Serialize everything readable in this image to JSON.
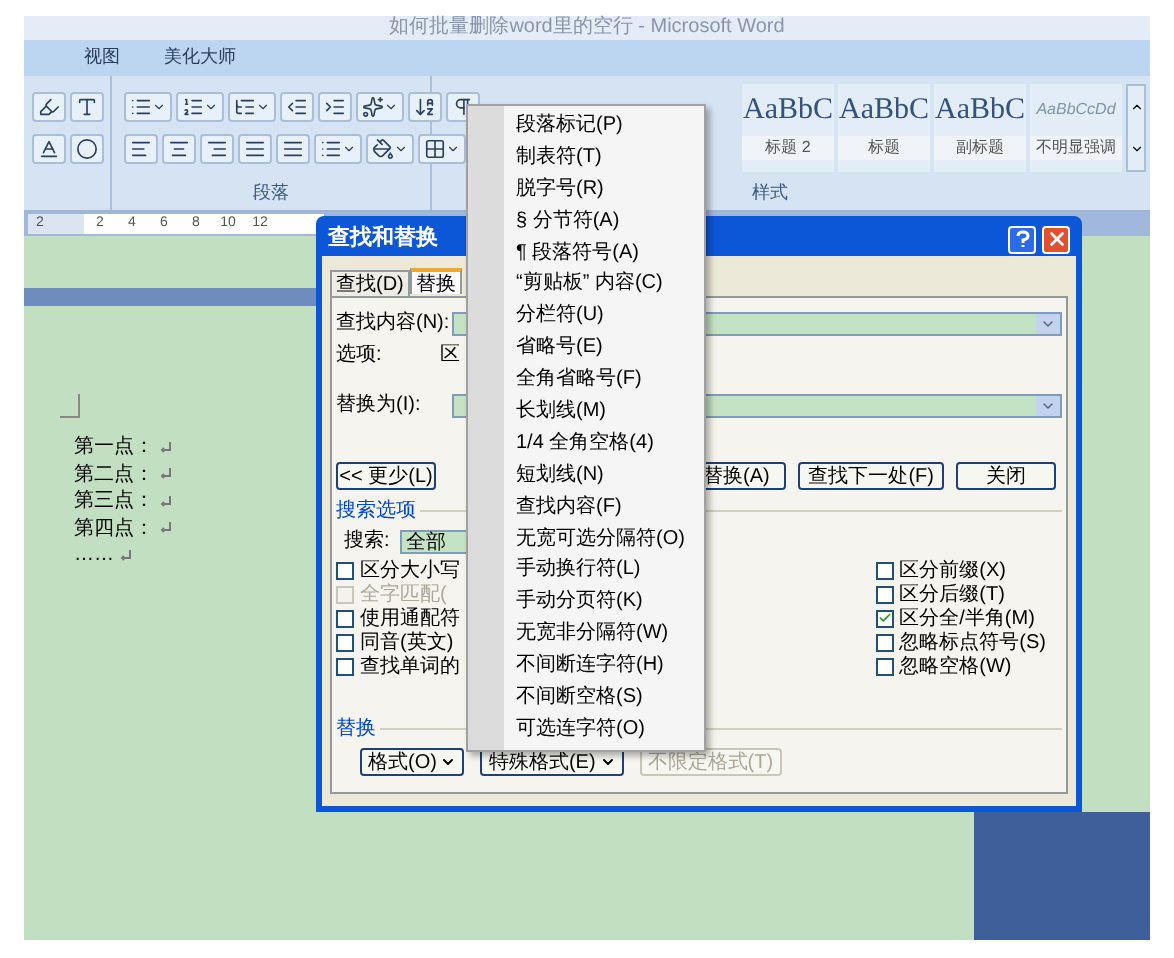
{
  "window": {
    "title": "如何批量删除word里的空行 - Microsoft Word"
  },
  "ribbon_tabs": [
    {
      "label": "视图",
      "selected": false
    },
    {
      "label": "美化大师",
      "selected": false
    }
  ],
  "paragraph_group": {
    "label": "段落"
  },
  "styles_group": {
    "label": "样式",
    "styles": [
      {
        "preview": "AaBbC",
        "label": "标题 2",
        "kind": "heading"
      },
      {
        "preview": "AaBbC",
        "label": "标题",
        "kind": "heading"
      },
      {
        "preview": "AaBbC",
        "label": "副标题",
        "kind": "heading"
      },
      {
        "preview": "AaBbCcDd",
        "label": "不明显强调",
        "kind": "emphasis"
      }
    ]
  },
  "ruler": {
    "marks": [
      "2",
      "2",
      "4",
      "6",
      "8",
      "10",
      "12"
    ]
  },
  "document": {
    "lines": [
      "第一点：",
      "第二点：",
      "第三点：",
      "第四点：",
      "……"
    ]
  },
  "dialog": {
    "title": "查找和替换",
    "tabs": [
      {
        "label": "查找(D)",
        "selected": false
      },
      {
        "label": "替换",
        "selected": true
      }
    ],
    "find_label": "查找内容(N):",
    "options_label": "选项:",
    "options_value": "区",
    "replace_label": "替换为(I):",
    "more_button": "<< 更少(L)",
    "action_buttons": [
      "替换(A)",
      "查找下一处(F)",
      "关闭"
    ],
    "search_options_title": "搜索选项",
    "search_label": "搜索:",
    "search_value": "全部",
    "options_left": [
      {
        "label": "区分大小写",
        "checked": false,
        "disabled": false
      },
      {
        "label": "全字匹配(",
        "checked": false,
        "disabled": true
      },
      {
        "label": "使用通配符",
        "checked": false,
        "disabled": false
      },
      {
        "label": "同音(英文)",
        "checked": false,
        "disabled": false
      },
      {
        "label": "查找单词的",
        "checked": false,
        "disabled": false
      }
    ],
    "options_right": [
      {
        "label": "区分前缀(X)",
        "checked": false
      },
      {
        "label": "区分后缀(T)",
        "checked": false
      },
      {
        "label": "区分全/半角(M)",
        "checked": true
      },
      {
        "label": "忽略标点符号(S)",
        "checked": false
      },
      {
        "label": "忽略空格(W)",
        "checked": false
      }
    ],
    "replace_section_title": "替换",
    "bottom_buttons": [
      {
        "label": "格式(O)",
        "dropdown": true,
        "disabled": false
      },
      {
        "label": "特殊格式(E)",
        "dropdown": true,
        "disabled": false
      },
      {
        "label": "不限定格式(T)",
        "dropdown": false,
        "disabled": true
      }
    ]
  },
  "special_menu": {
    "items": [
      "段落标记(P)",
      "制表符(T)",
      "脱字号(R)",
      "§ 分节符(A)",
      "¶ 段落符号(A)",
      "“剪贴板” 内容(C)",
      "分栏符(U)",
      "省略号(E)",
      "全角省略号(F)",
      "长划线(M)",
      "1/4 全角空格(4)",
      "短划线(N)",
      "查找内容(F)",
      "无宽可选分隔符(O)",
      "手动换行符(L)",
      "手动分页符(K)",
      "无宽非分隔符(W)",
      "不间断连字符(H)",
      "不间断空格(S)",
      "可选连字符(O)"
    ]
  }
}
